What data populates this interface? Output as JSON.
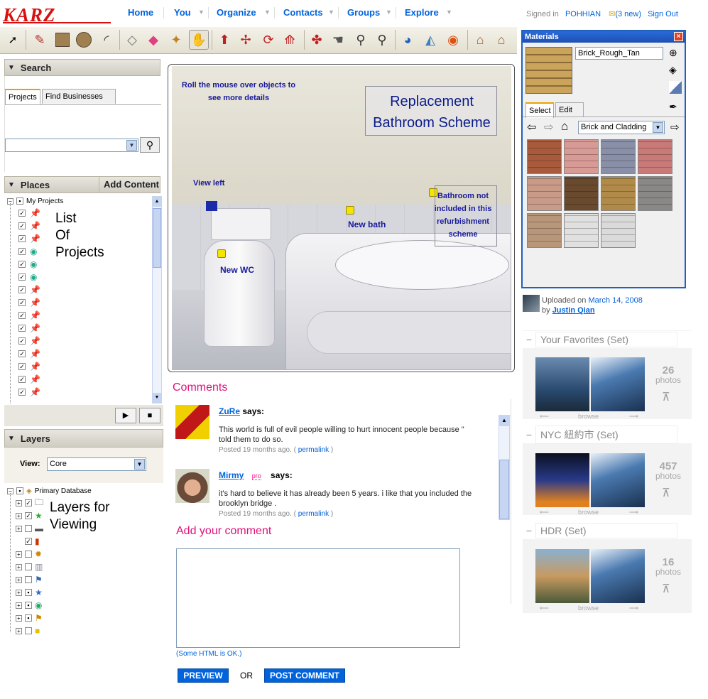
{
  "nav": {
    "logo": "KARZ",
    "items": [
      "Home",
      "You",
      "Organize",
      "Contacts",
      "Groups",
      "Explore"
    ],
    "signed_in_label": "Signed in",
    "username": "POHHIAN",
    "mail_count": "(3 new)",
    "sign_out": "Sign Out"
  },
  "toolbar": {
    "icons": [
      "select-icon",
      "pencil-icon",
      "rectangle-icon",
      "circle-icon",
      "arc-icon",
      "eraser-icon",
      "paint-bucket-icon",
      "tape-measure-icon",
      "text-icon",
      "push-pull-icon",
      "move-icon",
      "rotate-icon",
      "follow-me-icon",
      "orbit-icon",
      "pan-icon",
      "zoom-icon",
      "zoom-extents-icon",
      "earth-icon",
      "previous-view-icon",
      "google-earth-icon",
      "warehouse-icon",
      "share-model-icon"
    ]
  },
  "search_panel": {
    "title": "Search",
    "tabs": [
      "Projects",
      "Find Businesses"
    ],
    "input_value": ""
  },
  "places_panel": {
    "title": "Places",
    "add_content": "Add Content",
    "root": "My Projects",
    "list_label_lines": [
      "List",
      "Of",
      "Projects"
    ]
  },
  "layers_panel": {
    "title": "Layers",
    "view_label": "View:",
    "view_value": "Core",
    "root": "Primary Database",
    "big_label_lines": [
      "Layers for",
      "Viewing"
    ]
  },
  "photo": {
    "hint": "Roll the mouse over objects to see more details",
    "title_lines": [
      "Replacement",
      "Bathroom Scheme"
    ],
    "notes": {
      "view_left": "View left",
      "new_wc": "New WC",
      "new_bath": "New bath",
      "bathroom_not": "Bathroom not included in this refurbishment scheme"
    }
  },
  "comments": {
    "heading": "Comments",
    "items": [
      {
        "user": "ZuRe",
        "says": "says:",
        "text": "This world is full of evil people willing to hurt innocent people because \"",
        "text2": "told them to do so.",
        "meta": "Posted 19 months ago. (",
        "permalink": "permalink",
        "close": ")"
      },
      {
        "user": "Mirmy",
        "pro": "pro",
        "says": "says:",
        "text": "it's hard to believe it has already been 5 years. i like that you included the",
        "text2": "brooklyn bridge .",
        "meta": "Posted 19 months ago. (",
        "permalink": "permalink",
        "close": ")"
      }
    ],
    "add_heading": "Add your comment",
    "html_ok": "(Some HTML is OK.)",
    "preview": "PREVIEW",
    "or": "OR",
    "post": "POST COMMENT"
  },
  "materials": {
    "title": "Materials",
    "current": "Brick_Rough_Tan",
    "tabs": [
      "Select",
      "Edit"
    ],
    "library": "Brick and Cladding",
    "swatches": [
      "#a85a3c",
      "#d89a94",
      "#8a8fa8",
      "#c87a78",
      "#c89a88",
      "#6a4a2e",
      "#b08a48",
      "#8a8886",
      "#b8967a",
      "#e0e0e0",
      "#dadada"
    ]
  },
  "upload": {
    "prefix": "Uploaded on",
    "date": "March 14, 2008",
    "by": "by",
    "user": "Justin Qian"
  },
  "sets": [
    {
      "name": "Your Favorites (Set)",
      "count": "26",
      "unit": "photos",
      "browse": "browse"
    },
    {
      "name": "NYC 紐約市 (Set)",
      "count": "457",
      "unit": "photos",
      "browse": "browse"
    },
    {
      "name": "HDR (Set)",
      "count": "16",
      "unit": "photos",
      "browse": "browse"
    }
  ]
}
